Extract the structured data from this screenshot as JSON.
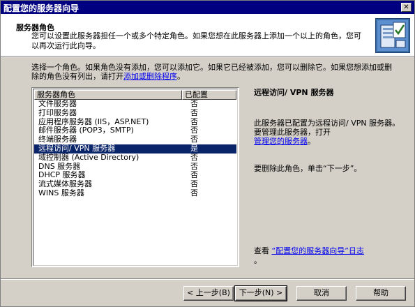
{
  "window": {
    "title": "配置您的服务器向导",
    "close_label": "✕"
  },
  "header": {
    "title": "服务器角色",
    "description": "您可以设置此服务器担任一个或多个特定角色。如果您想在此服务器上添加一个以上的角色，您可以再次运行此向导。",
    "icon": "server-role-wizard-icon"
  },
  "intro": {
    "text": "选择一个角色。如果角色没有添加，您可以添加它。如果它已经被添加，您可以删除它。如果您想添加或删除的角色没有列出，请打开",
    "link": "添加或删除程序",
    "suffix": "。"
  },
  "list": {
    "columns": [
      "服务器角色",
      "已配置"
    ],
    "rows": [
      {
        "role": "文件服务器",
        "configured": "否"
      },
      {
        "role": "打印服务器",
        "configured": "否"
      },
      {
        "role": "应用程序服务器 (IIS，ASP.NET)",
        "configured": "否"
      },
      {
        "role": "邮件服务器 (POP3，SMTP)",
        "configured": "否"
      },
      {
        "role": "终端服务器",
        "configured": "否"
      },
      {
        "role": "远程访问/ VPN 服务器",
        "configured": "是",
        "selected": true
      },
      {
        "role": "域控制器 (Active Directory)",
        "configured": "否"
      },
      {
        "role": "DNS 服务器",
        "configured": "否"
      },
      {
        "role": "DHCP 服务器",
        "configured": "否"
      },
      {
        "role": "流式媒体服务器",
        "configured": "否"
      },
      {
        "role": "WINS 服务器",
        "configured": "否"
      }
    ]
  },
  "side": {
    "title": "远程访问/ VPN 服务器",
    "configured_text": "此服务器已配置为远程访问/ VPN 服务器。",
    "manage_text": "要管理此服务器，打开",
    "manage_link": "管理您的服务器",
    "manage_suffix": "。",
    "remove_text": "要删除此角色，单击“下一步”。",
    "log_prefix": "查看",
    "log_link": "“配置您的服务器向导”日志",
    "log_suffix": "。"
  },
  "buttons": {
    "back": "< 上一步(B)",
    "next": "下一步(N) >",
    "cancel": "取消",
    "help": "帮助"
  },
  "colors": {
    "title_bar": "#000080",
    "selection": "#0a246a",
    "link": "#0000ee",
    "face": "#d4d0c8"
  }
}
